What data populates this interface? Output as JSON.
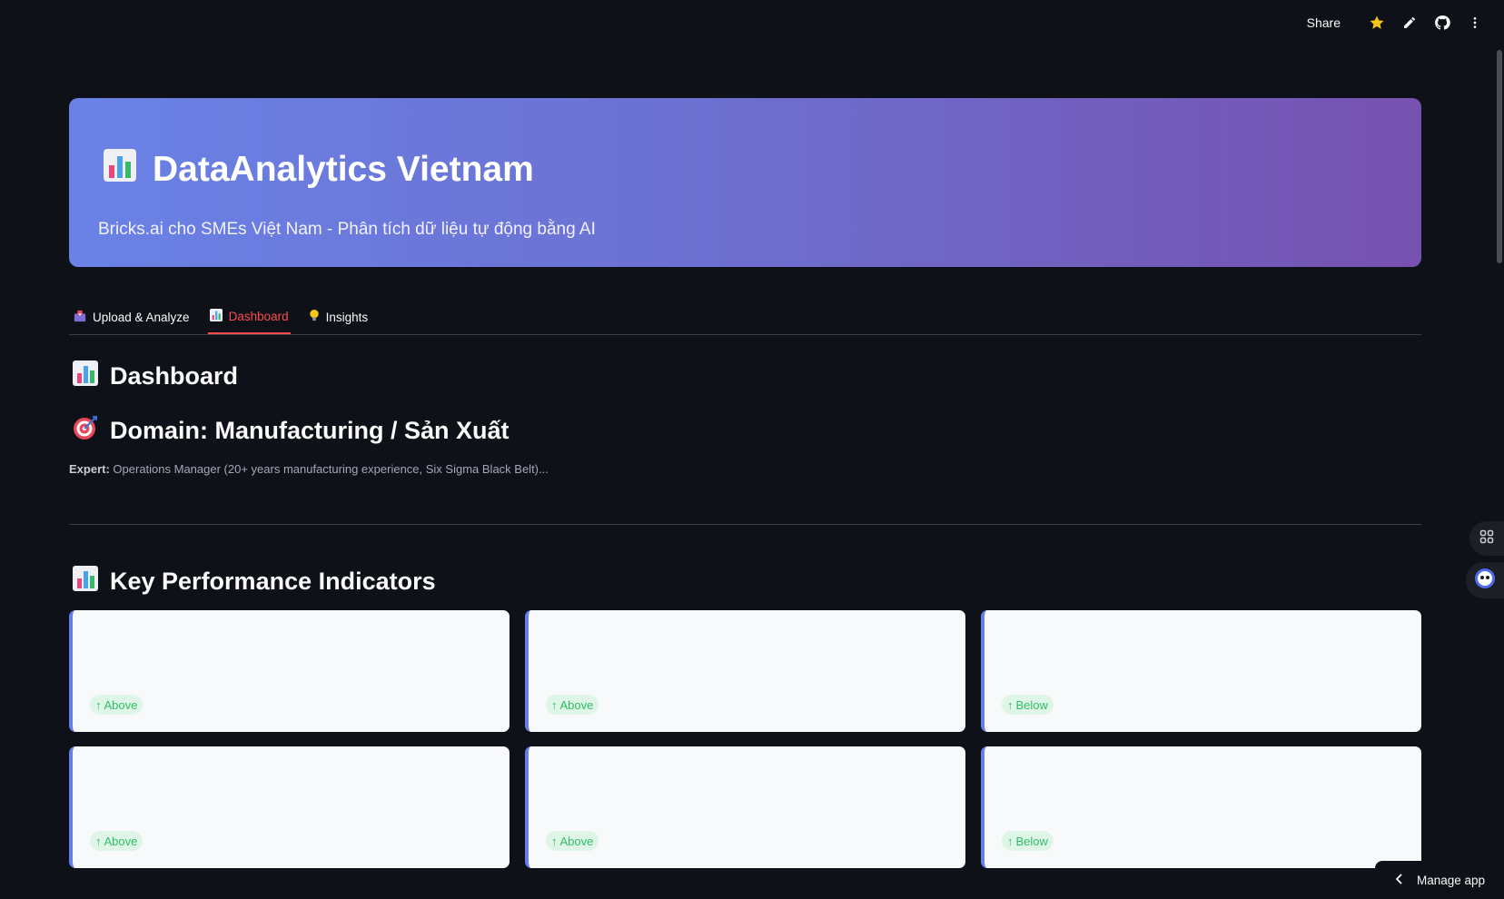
{
  "topbar": {
    "share_label": "Share"
  },
  "hero": {
    "title": "DataAnalytics Vietnam",
    "subtitle": "Bricks.ai cho SMEs Việt Nam - Phân tích dữ liệu tự động bằng AI"
  },
  "tabs": [
    {
      "label": "Upload & Analyze",
      "icon": "inbox-tray-icon",
      "active": false
    },
    {
      "label": "Dashboard",
      "icon": "bar-chart-icon",
      "active": true
    },
    {
      "label": "Insights",
      "icon": "lightbulb-icon",
      "active": false
    }
  ],
  "dashboard": {
    "heading": "Dashboard",
    "domain_heading": "Domain: Manufacturing / Sản Xuất",
    "expert_label": "Expert:",
    "expert_text": "Operations Manager (20+ years manufacturing experience, Six Sigma Black Belt)..."
  },
  "kpi": {
    "heading": "Key Performance Indicators",
    "cards": [
      {
        "badge": "Above"
      },
      {
        "badge": "Above"
      },
      {
        "badge": "Below"
      },
      {
        "badge": "Above"
      },
      {
        "badge": "Above"
      },
      {
        "badge": "Below"
      }
    ]
  },
  "manage_app_label": "Manage app",
  "colors": {
    "background": "#0e1117",
    "accent_tab": "#ff4b4b",
    "hero_gradient_start": "#6a82e6",
    "hero_gradient_end": "#7651b0",
    "badge_green": "#2fbf63",
    "card_border": "#667eea"
  }
}
